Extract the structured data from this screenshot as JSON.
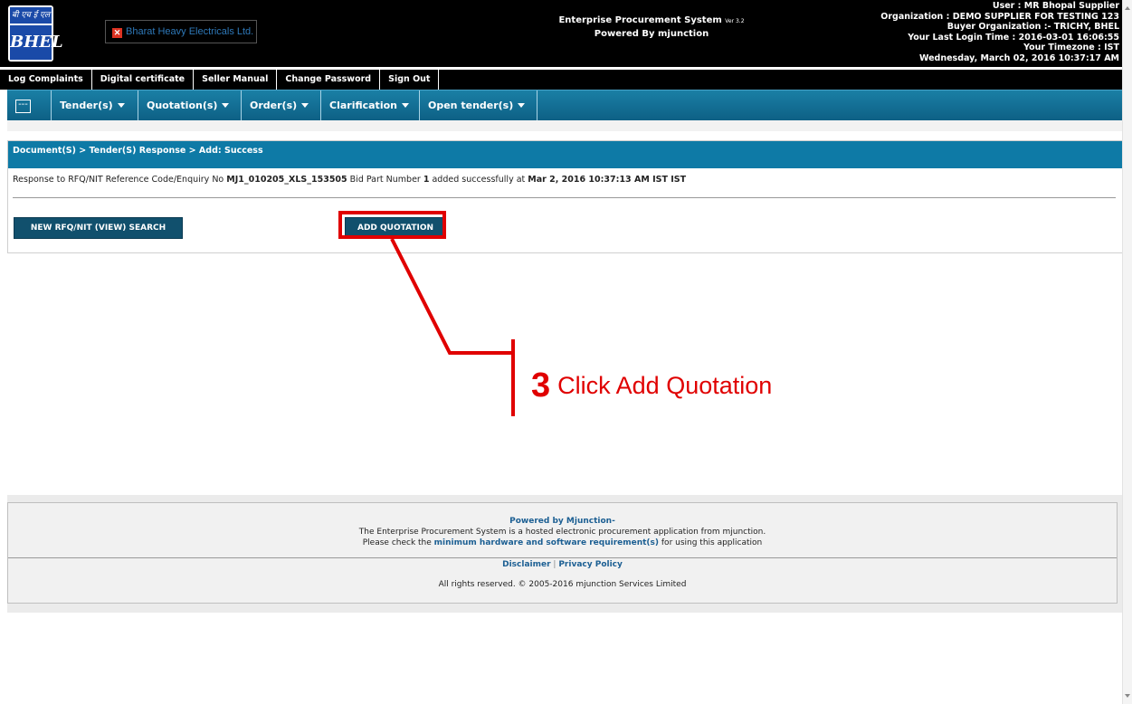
{
  "header": {
    "logo_top": "बी एच ई एल",
    "logo_main": "BHEL",
    "broken_image_alt": "Bharat Heavy Electricals Ltd.",
    "system_title": "Enterprise Procurement System",
    "version": "Ver 3.2",
    "powered_by": "Powered By mjunction",
    "user_info": [
      "User : MR Bhopal Supplier",
      "Organization : DEMO SUPPLIER FOR TESTING 123",
      "Buyer Organization :- TRICHY, BHEL",
      "Your Last Login Time : 2016-03-01 16:06:55",
      "Your Timezone : IST",
      "Wednesday, March 02, 2016  10:37:17 AM"
    ]
  },
  "top_links": [
    "Log Complaints",
    "Digital certificate",
    "Seller Manual",
    "Change Password",
    "Sign Out"
  ],
  "nav": {
    "collapse_symbol": "---",
    "items": [
      "Tender(s)",
      "Quotation(s)",
      "Order(s)",
      "Clarification",
      "Open tender(s)"
    ]
  },
  "content": {
    "breadcrumb": "Document(S) > Tender(S) Response > Add: Success",
    "message": {
      "prefix": "Response to RFQ/NIT Reference Code/Enquiry No ",
      "enquiry_no": "MJ1_010205_XLS_153505",
      "mid": " Bid Part Number ",
      "bid_part": "1",
      "suffix": " added successfully at ",
      "timestamp": "Mar 2, 2016 10:37:13 AM IST IST"
    },
    "search_button": "NEW RFQ/NIT (VIEW) SEARCH",
    "add_quotation_button": "ADD QUOTATION"
  },
  "annotation": {
    "step": "3",
    "label": "Click Add Quotation",
    "color": "#e00000"
  },
  "footer": {
    "powered": "Powered by Mjunction-",
    "line1": "The Enterprise Procurement System is a hosted electronic procurement application from mjunction.",
    "line2_prefix": "Please check the ",
    "line2_link": "minimum hardware and software requirement(s)",
    "line2_suffix": " for using this application",
    "disclaimer": "Disclaimer",
    "separator": "|",
    "privacy": "Privacy Policy",
    "copyright": "All rights reserved. © 2005-2016 mjunction Services Limited"
  },
  "colors": {
    "header_bg": "#000000",
    "nav_bg": "#0e7aa6",
    "button_bg": "#11506d",
    "highlight": "#e00000"
  }
}
